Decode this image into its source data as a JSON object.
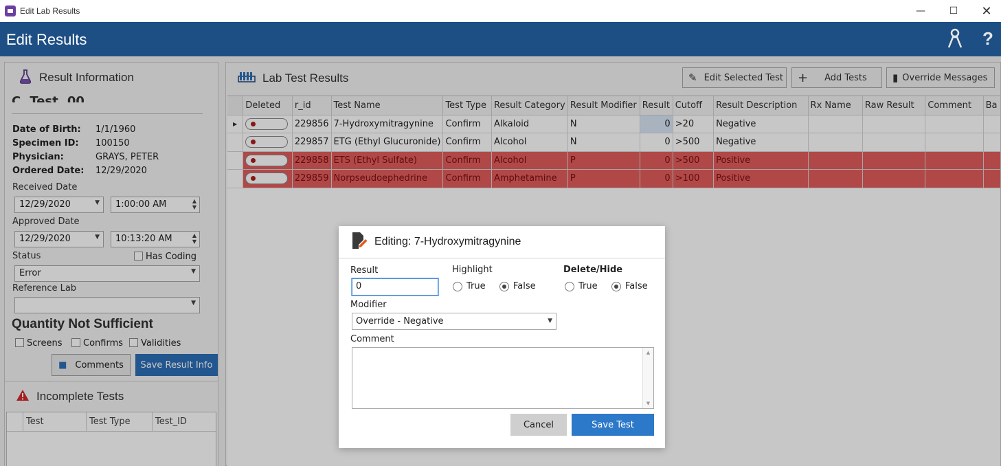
{
  "window": {
    "title": "Edit Lab Results"
  },
  "header": {
    "title": "Edit Results",
    "help_label": "?"
  },
  "left": {
    "panel_title": "Result Information",
    "patient_name_partial": "C. Test, 00",
    "info": [
      {
        "label": "Date of Birth:",
        "value": "1/1/1960"
      },
      {
        "label": "Specimen ID:",
        "value": "100150"
      },
      {
        "label": "Physician:",
        "value": "GRAYS, PETER"
      },
      {
        "label": "Ordered Date:",
        "value": "12/29/2020"
      }
    ],
    "received_label": "Received Date",
    "received_date": "12/29/2020",
    "received_time": "1:00:00 AM",
    "approved_label": "Approved Date",
    "approved_date": "12/29/2020",
    "approved_time": "10:13:20 AM",
    "status_label": "Status",
    "has_coding_label": "Has Coding",
    "status_value": "Error",
    "reference_lab_label": "Reference Lab",
    "qns_title": "Quantity Not Sufficient",
    "qns_screens": "Screens",
    "qns_confirms": "Confirms",
    "qns_validities": "Validities",
    "comments_button": "Comments",
    "save_result_info_button": "Save Result Info",
    "incomplete_title": "Incomplete Tests",
    "incomplete_columns": [
      "Test",
      "Test Type",
      "Test_ID"
    ]
  },
  "right": {
    "panel_title": "Lab Test Results",
    "edit_selected_button": "Edit Selected Test",
    "add_tests_button": "Add Tests",
    "override_messages_button": "Override Messages",
    "columns": [
      "Deleted",
      "r_id",
      "Test Name",
      "Test Type",
      "Result Category",
      "Result Modifier",
      "Result",
      "Cutoff",
      "Result Description",
      "Rx Name",
      "Raw Result",
      "Comment",
      "Ba"
    ],
    "rows": [
      {
        "r_id": "229856",
        "test_name": "7-Hydroxymitragynine",
        "test_type": "Confirm",
        "category": "Alkaloid",
        "modifier": "N",
        "result": "0",
        "cutoff": ">20",
        "description": "Negative",
        "highlight": false,
        "selected": true
      },
      {
        "r_id": "229857",
        "test_name": "ETG (Ethyl Glucuronide)",
        "test_type": "Confirm",
        "category": "Alcohol",
        "modifier": "N",
        "result": "0",
        "cutoff": ">500",
        "description": "Negative",
        "highlight": false,
        "selected": false
      },
      {
        "r_id": "229858",
        "test_name": "ETS (Ethyl Sulfate)",
        "test_type": "Confirm",
        "category": "Alcohol",
        "modifier": "P",
        "result": "0",
        "cutoff": ">500",
        "description": "Positive",
        "highlight": true,
        "selected": false
      },
      {
        "r_id": "229859",
        "test_name": "Norpseudoephedrine",
        "test_type": "Confirm",
        "category": "Amphetamine",
        "modifier": "P",
        "result": "0",
        "cutoff": ">100",
        "description": "Positive",
        "highlight": true,
        "selected": false
      }
    ]
  },
  "dialog": {
    "title": "Editing: 7-Hydroxymitragynine",
    "result_label": "Result",
    "result_value": "0",
    "highlight_label": "Highlight",
    "delete_hide_label": "Delete/Hide",
    "true_label": "True",
    "false_label": "False",
    "highlight_selected": "False",
    "delete_hide_selected": "False",
    "modifier_label": "Modifier",
    "modifier_value": "Override - Negative",
    "comment_label": "Comment",
    "comment_value": "",
    "cancel_button": "Cancel",
    "save_button": "Save Test"
  },
  "colors": {
    "header_blue": "#1d4f84",
    "accent_blue": "#2c6fb8",
    "highlight_red": "#e35d5d"
  }
}
